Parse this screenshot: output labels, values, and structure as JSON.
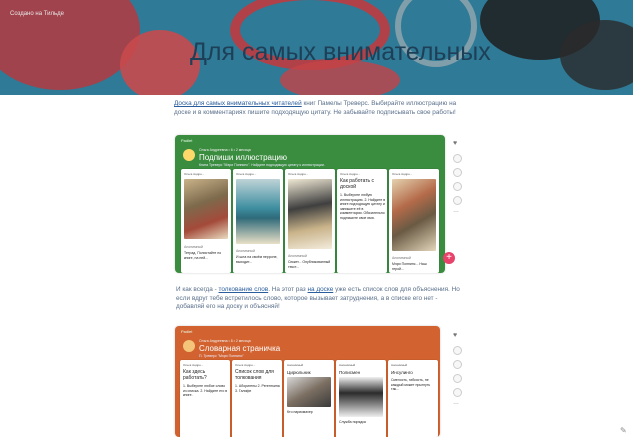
{
  "site_brand": "Создано на Тильде",
  "page_title": "Для самых внимательных",
  "intro": {
    "link": "Доска для самых внимательных читателей",
    "text": " книг Памелы Треверс. Выбирайте иллюстрацию на доске и в комментариях пишите подходящую цитату. Не забывайте подписывать свое работы!"
  },
  "board1": {
    "label": "Padlet",
    "meta": "Ольга Андреевна • 6 • 2 месяца",
    "title": "Подпиши иллюстрацию",
    "subtitle": "Книга Треверс \"Мэри Поппинс\". Найдите подходящую цитату к иллюстрации.",
    "cards": [
      {
        "author": "Ольга Андре...",
        "comment_author": "Анонимный",
        "comment": "Тетрад. Полистайте по книге, на ней..."
      },
      {
        "author": "Ольга Андре...",
        "comment_author": "Анонимный",
        "comment": "И шла на своём перроне, выходит..."
      },
      {
        "author": "Ольга Андре...",
        "comment_author": "Анонимный",
        "comment": "Сюжет... Опубликованный текст..."
      },
      {
        "author": "Ольга Андре...",
        "text": "Как работать с доской",
        "body": "1. Выберите любую иллюстрацию. 2. Найдите в книге подходящую цитату и запишите её в комментарии. Обязательно подпишите свое имя."
      },
      {
        "author": "Ольга Андре...",
        "comment_author": "Анонимный",
        "comment": "Мэри Поппинс... Наш герой..."
      }
    ]
  },
  "middle": {
    "prefix": "И как всегда - ",
    "link1": "толкование слов",
    "part2": ". На этот раз ",
    "link2": "на доске",
    "suffix": " уже есть список слов для объяснения. Но если вдруг тебе встретилось слово, которое вызывает затруднения, а в списке его нет - добавляй его на доску и объясняй!"
  },
  "board2": {
    "label": "Padlet",
    "meta": "Ольга Андреевна • 8 • 2 месяца",
    "title": "Словарная страничка",
    "subtitle": "П. Треверс \"Мэри Поппинс\"",
    "cards": [
      {
        "author": "Ольга Андре...",
        "text": "Как здесь работать?",
        "body": "1. Выберите любое слово из списка. 2. Найдите его в книге."
      },
      {
        "author": "Ольга Андре...",
        "text": "Список слов для толкования",
        "body": "1. Аборигены 2. Регенткина 3. Галифе"
      },
      {
        "author": "Анонимный",
        "text": "Цирюльник",
        "pic_caption": "Кто парикмахер"
      },
      {
        "author": "Анонимный",
        "text": "Полисмен",
        "pic_caption": "Служба порядка"
      },
      {
        "author": "Анонимный",
        "text": "Инсулинго",
        "body": "Смелость, гибкость, не каждый может прыгнуть так..."
      }
    ]
  },
  "side_icons": [
    "heart-icon",
    "share-icon",
    "copy-icon",
    "download-icon",
    "fullscreen-icon",
    "more-icon"
  ],
  "add_button": "+",
  "edit_icon": "✎",
  "colors": {
    "banner": "#2f7a96",
    "board1": "#3a8c3f",
    "board2": "#d2622f",
    "accent": "#e8416a"
  }
}
